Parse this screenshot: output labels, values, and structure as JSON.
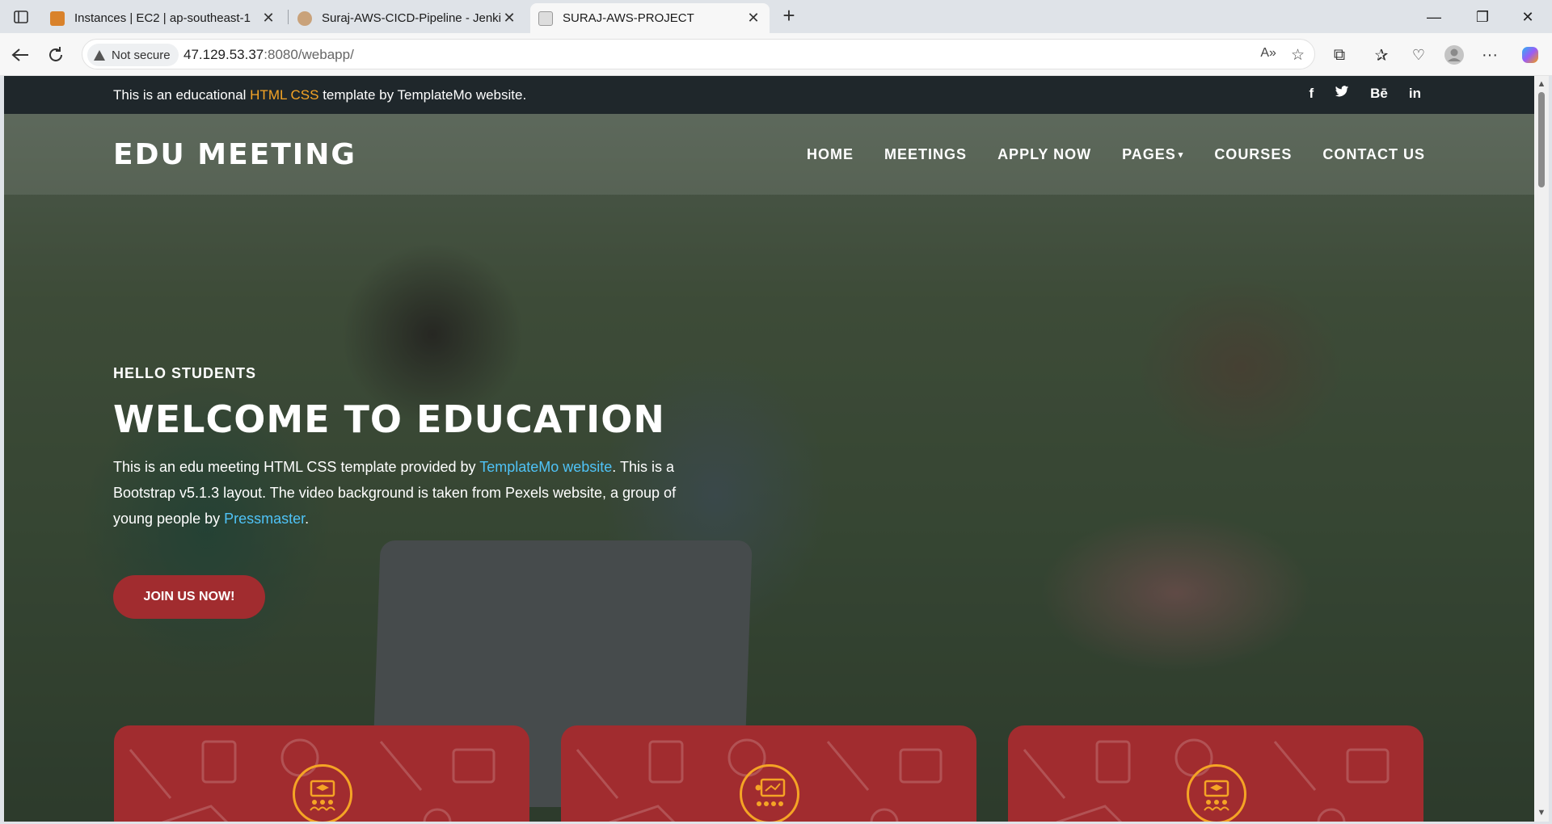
{
  "browser": {
    "tabs": [
      {
        "title": "Instances | EC2 | ap-southeast-1",
        "active": false,
        "favicon": "aws-favicon-icon"
      },
      {
        "title": "Suraj-AWS-CICD-Pipeline - Jenkins",
        "active": false,
        "favicon": "jenkins-favicon-icon"
      },
      {
        "title": "SURAJ-AWS-PROJECT",
        "active": true,
        "favicon": "broken-page-favicon-icon"
      }
    ],
    "security_label": "Not secure",
    "url_host": "47.129.53.37",
    "url_rest": ":8080/webapp/"
  },
  "page": {
    "sub_header": {
      "text_before": "This is an educational ",
      "highlight": "HTML CSS",
      "text_after": " template by TemplateMo website.",
      "social": [
        "f",
        "twitter",
        "Bē",
        "in"
      ]
    },
    "logo": "EDU MEETING",
    "nav": [
      "HOME",
      "MEETINGS",
      "APPLY NOW",
      "PAGES",
      "COURSES",
      "CONTACT US"
    ],
    "caption": {
      "subtitle": "HELLO STUDENTS",
      "title": "WELCOME TO EDUCATION",
      "p1": "This is an edu meeting HTML CSS template provided by ",
      "link1": "TemplateMo website",
      "p2": ". This is a Bootstrap v5.1.3 layout. The video background is taken from Pexels website, a group of young people by ",
      "link2": "Pressmaster",
      "p3": ".",
      "button": "JOIN US NOW!"
    },
    "colors": {
      "accent": "#f5a425",
      "brand_red": "#a12c2f",
      "link": "#4fc3f7",
      "topbar": "#1f272b"
    }
  }
}
